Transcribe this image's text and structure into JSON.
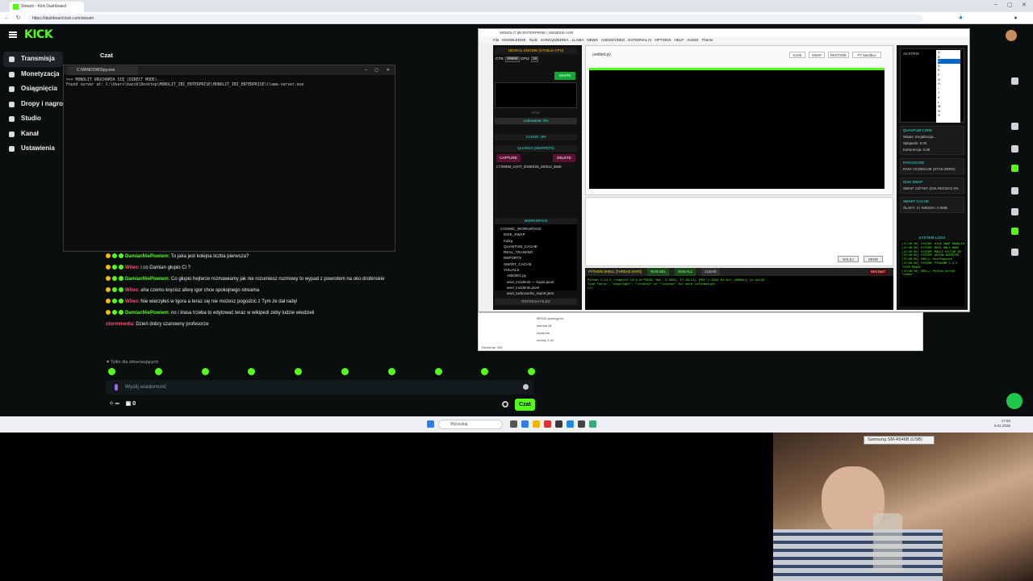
{
  "browser": {
    "tab_title": "Stream - Kick Dashboard",
    "url": "https://dashboard.kick.com/stream"
  },
  "kick": {
    "logo": "KICK",
    "sidebar": [
      {
        "label": "Transmisja",
        "active": true
      },
      {
        "label": "Monetyzacja"
      },
      {
        "label": "Osiągnięcia"
      },
      {
        "label": "Dropy i nagrody"
      },
      {
        "label": "Studio"
      },
      {
        "label": "Kanał"
      },
      {
        "label": "Ustawienia"
      }
    ],
    "chat_title": "Czat",
    "messages": [
      {
        "user": "Wileo",
        "text": ":",
        "user_color": "#ff4d6d",
        "emote": true
      },
      {
        "user": "sponsor_patologii",
        "text": ":",
        "user_color": "#ffffff",
        "emote": true,
        "plain": true
      },
      {
        "user": "DamianNiePowiem",
        "text": ": To jaka jest kolejna liczba pierwsza?",
        "user_color": "#53fc18"
      },
      {
        "user": "Wileo",
        "text": ": i co Damian głupio Ci ?",
        "user_color": "#ff4d6d"
      },
      {
        "user": "DamianNiePowiem",
        "text": ": Co głupio hejterze rozmawiamy jak nie rozumiesz rozmowy to wypad z powrotem na oko drobinskie",
        "user_color": "#53fc18"
      },
      {
        "user": "Wileo",
        "text": ": aha czemu kręcisz aferę igor chce spokojnego streama",
        "user_color": "#ff4d6d"
      },
      {
        "user": "Wileo",
        "text": ": Nie wierzyłeś w Igora a teraz się nie możesz pogodzić z Tym ze dał radę!",
        "user_color": "#ff4d6d"
      },
      {
        "user": "DamianNiePowiem",
        "text": ": no i klasa trzeba to edytować teraz w wikipedi zeby ludzie wiedzieli",
        "user_color": "#53fc18"
      },
      {
        "user": "stormmedia",
        "text": ": Dzień dobry szanowny profesorze",
        "user_color": "#ff4d6d",
        "plain": true
      }
    ],
    "followers_only": "Tylko dla obserwujących",
    "input_placeholder": "Wyślij wiadomość",
    "viewers_label": "∞",
    "gift_count": "0",
    "send_label": "Czat"
  },
  "cmd": {
    "title": "C:\\WINDOWS\\py.exe",
    "output": ">>> MONOLIT URUCHAMIA SIĘ (DIRECT MODE)...\nFound server at: C:\\Users\\kazik\\Desktop\\MONOLIT_IBI_ENTERPRISE\\MONOLIT_IBI_ENTERPRISE\\llama-server.exe"
  },
  "app": {
    "title": "MONOLIT IBI ENTERPRISE | GENESIS AUR",
    "menu": [
      "File",
      "KNOWLEDGE",
      "Tools",
      "ZARZĄDZEDNIA",
      "LLAMA",
      "NEWS",
      "AUDIO/VIDEO",
      "EXTERNAL AI",
      "OPTIONS",
      "HELP",
      "AUDIO",
      "Theme"
    ],
    "neural_engine": "NEURAL ENGINE (STABLE-CPU)",
    "ctx_label": "CTX:",
    "ctx_value": "99999",
    "cpu_label": "CPU:",
    "cpu_value": "16",
    "ignite": "IGNITE",
    "idle": "IDLE",
    "loading": "Ładowanie: 0%",
    "cache": "CACHE: ON",
    "quarks": "QUARKS (SNIPPETS)",
    "capture": "CAPTURE",
    "delete": "DELETE",
    "snippet": "CTXMEM_CHAT_20260105_230012_8648",
    "workspace": "WORKSPACE",
    "tree": [
      "COSMIC_WORKSPACE",
      "DISK_SWAP",
      "mdzg",
      "QUANTUM_CACHE",
      "REAL_TRAINING",
      "REPORTS",
      "SMART_CACHE",
      "VISUALS",
      "AIBORG.py",
      "ariel_incidents — kopia.jsonl",
      "ariel_incidents.jsonl",
      "ariel_turbocache_report.json"
    ],
    "refresh": "REFRESH FILES",
    "file_name": "untitled.py",
    "editor_buttons": [
      "SAVE",
      "SWAP",
      "RESTORE",
      "PY Sandbox"
    ],
    "dalej": "DALEJ",
    "send": "SEND",
    "shell_title": "PYTHON SHELL [THREAD SAFE]",
    "shell_buttons": [
      "RUN SEL",
      "RUN ALL",
      "CLEAR"
    ],
    "restart": "RESTART",
    "shell_output": "Python 3.14.2 (tags/v3.14.2:df79316, Dec  5 2025, 17:18:21) [MSC v.1944 64 bit (AMD64)] on win32\nType \"help\", \"copyright\", \"credits\" or \"license\" for more information.\n>>>",
    "acxtrix": "ACXTRIX",
    "acx_options": [
      "A",
      "B",
      "C",
      "D",
      "E",
      "F",
      "G",
      "H",
      "I",
      "J",
      "K",
      "L",
      "M",
      "N",
      "O"
    ],
    "panels": [
      {
        "title": "QUANTUM CORE",
        "lines": [
          "Status: Inicjalizacja...",
          "Splątanie: 0.00",
          "Koherencja: 0.00"
        ]
      },
      {
        "title": "RAM USAGE",
        "lines": [
          "RAM: OCZEKUJE (STAN ZERO)"
        ]
      },
      {
        "title": "DISK SWAP",
        "lines": [
          "SWAP: OŻYWY (SOLFEGGIO) 0%"
        ]
      },
      {
        "title": "SMART CACHE",
        "lines": [
          "ŚLADY: 4 | WIEDZA: 0.0MB"
        ]
      }
    ],
    "syslogs_title": "SYSTEM LOGS",
    "syslogs": "[17:46:36] SYSTEM: DISK SWAP ENABLED\n[17:46:36] SYSTEM: REAL ONLY MODE\n[17:46:36] SYSTEM: MAGIC ESCTOR ON\n[17:46:36] SYSTEM: ORIGN INJECTED\n[17:46:36] SHELL: RustPowered\n[17:46:36] SYSTEM: PYSDIMM 1.2.5\n\"SYSP READY\n[17:46:36] SHELL: Python kernel\n\"ready\""
  },
  "explorer": {
    "rows": [
      "MEDZI-synergy.txt",
      "internal.dll",
      "equip.sm",
      "money 1.txt"
    ],
    "status": "Elements: 154"
  },
  "taskbar": {
    "search": "Wyszukaj",
    "time": "17:50",
    "date": "6.01.2026"
  },
  "webcam": {
    "device": "Samsung SM-A546B (USB)"
  }
}
